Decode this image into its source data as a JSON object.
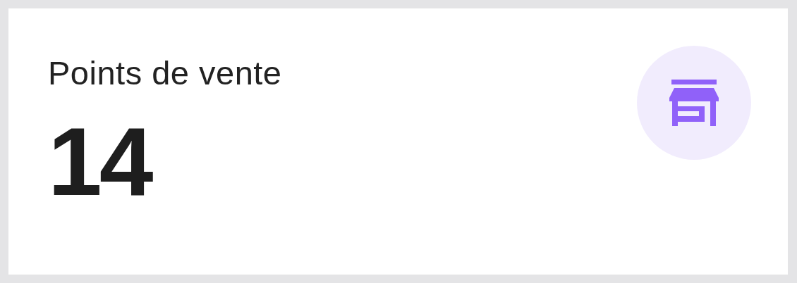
{
  "card": {
    "title": "Points de vente",
    "value": "14"
  }
}
